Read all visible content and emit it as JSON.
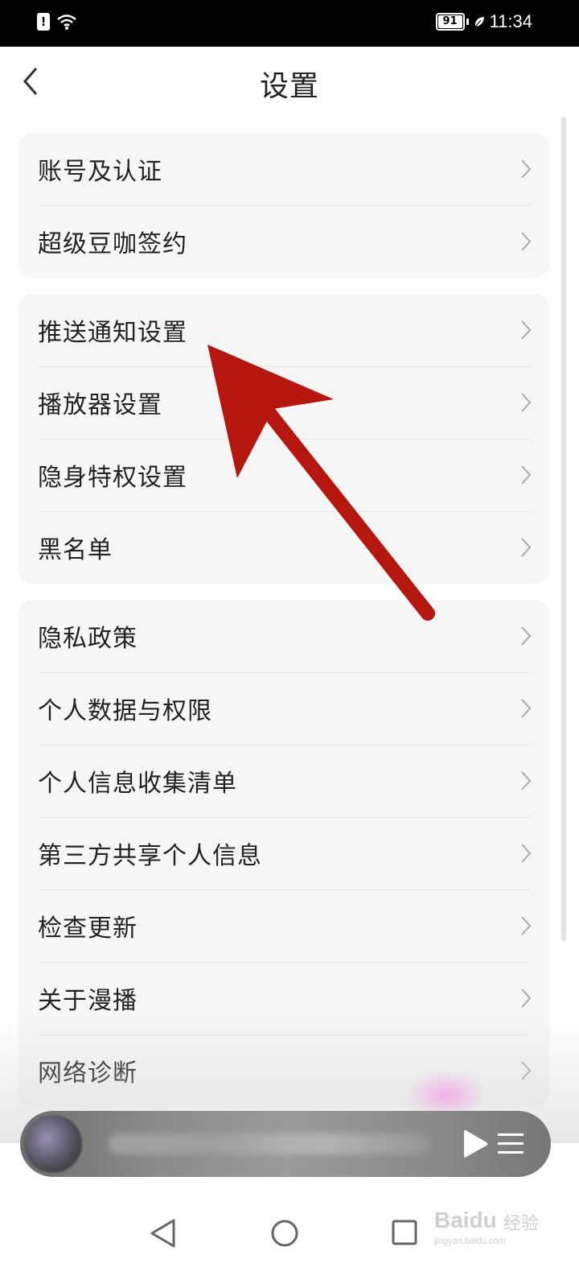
{
  "status_bar": {
    "time": "11:34",
    "battery": "91",
    "alert_glyph": "!"
  },
  "header": {
    "title": "设置"
  },
  "groups": [
    {
      "items": [
        {
          "label": "账号及认证"
        },
        {
          "label": "超级豆咖签约"
        }
      ]
    },
    {
      "items": [
        {
          "label": "推送通知设置"
        },
        {
          "label": "播放器设置"
        },
        {
          "label": "隐身特权设置"
        },
        {
          "label": "黑名单"
        }
      ]
    },
    {
      "items": [
        {
          "label": "隐私政策"
        },
        {
          "label": "个人数据与权限"
        },
        {
          "label": "个人信息收集清单"
        },
        {
          "label": "第三方共享个人信息"
        },
        {
          "label": "检查更新"
        },
        {
          "label": "关于漫播"
        },
        {
          "label": "网络诊断"
        }
      ]
    }
  ],
  "icons": {
    "back": "chevron-left-icon",
    "row": "chevron-right-icon",
    "play": "play-icon",
    "playlist": "playlist-icon"
  },
  "watermark": {
    "brand": "Baidu",
    "suffix": "经验",
    "url": "jingyan.baidu.com"
  },
  "colors": {
    "annotation_arrow": "#b5170f",
    "card_background": "#f6f6f6"
  }
}
